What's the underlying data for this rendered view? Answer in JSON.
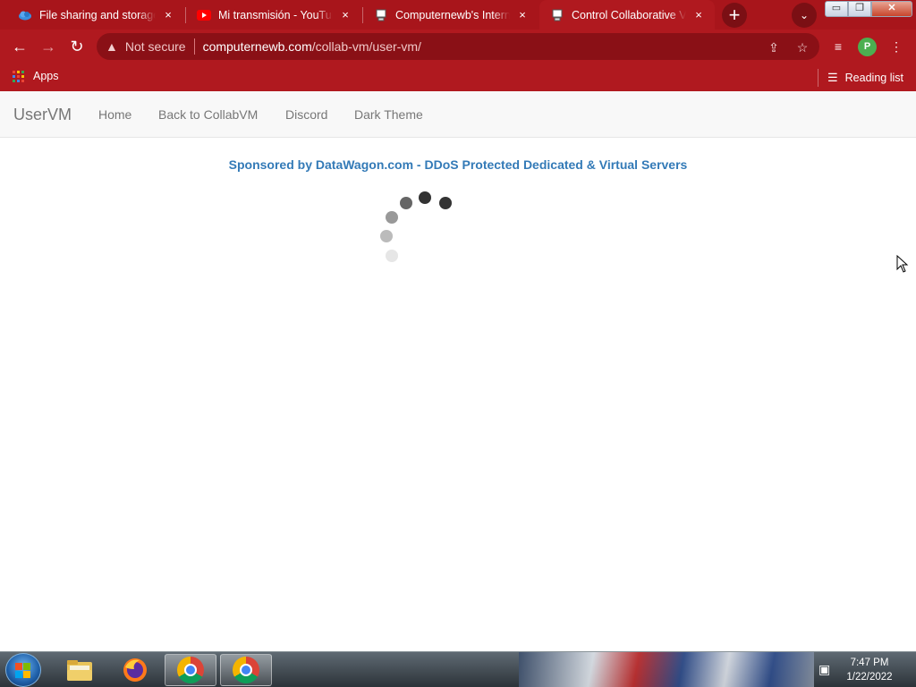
{
  "browser": {
    "tabs": [
      {
        "title": "File sharing and storage made simple",
        "close": "×",
        "icon": "cloud-icon"
      },
      {
        "title": "Mi transmisión - YouTube",
        "close": "×",
        "icon": "youtube-icon"
      },
      {
        "title": "Computernewb's Internet Computer",
        "close": "×",
        "icon": "computer-icon"
      },
      {
        "title": "Control Collaborative Virtual Machines",
        "close": "×",
        "icon": "computer-icon"
      }
    ],
    "new_tab": "+",
    "tab_search": "⌄",
    "window_controls": {
      "minimize": "▭",
      "maximize": "❐",
      "close": "✕"
    },
    "nav": {
      "back": "←",
      "forward": "→",
      "reload": "↻"
    },
    "omnibox": {
      "security": "Not secure",
      "domain": "computernewb.com",
      "path": "/collab-vm/user-vm/"
    },
    "profile_initial": "P",
    "bookmarks": {
      "apps": "Apps",
      "reading_list": "Reading list"
    }
  },
  "page": {
    "brand": "UserVM",
    "nav_links": [
      "Home",
      "Back to CollabVM",
      "Discord",
      "Dark Theme"
    ],
    "sponsor": "Sponsored by DataWagon.com - DDoS Protected Dedicated & Virtual Servers"
  },
  "taskbar": {
    "time": "7:47 PM",
    "date": "1/22/2022",
    "apps": [
      "folder-icon",
      "firefox-icon",
      "chrome-icon",
      "chrome-icon"
    ]
  },
  "colors": {
    "chrome_theme": "#b0191f",
    "link": "#337ab7"
  }
}
